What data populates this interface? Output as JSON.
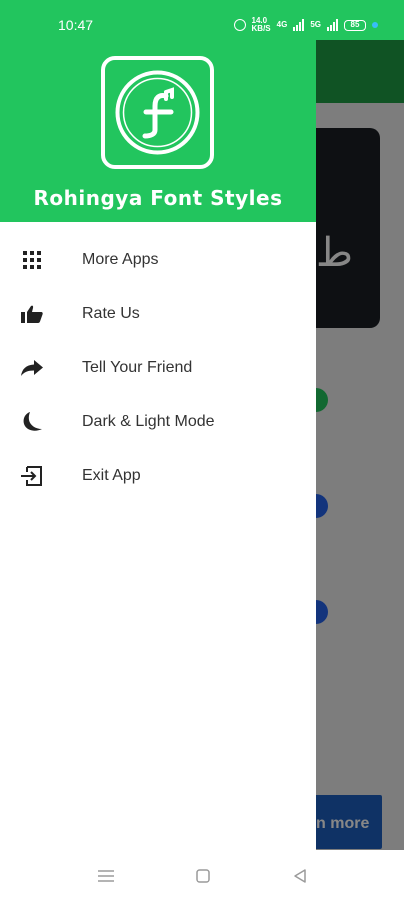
{
  "status_bar": {
    "time": "10:47",
    "net_speed_a": "14.0",
    "net_speed_a_unit": "KB/S",
    "network_type": "4G",
    "signal_label": "5G",
    "battery": "85"
  },
  "drawer": {
    "app_name": "Rohingya Font Styles",
    "logo_letter": "f",
    "menu": [
      {
        "label": "More Apps",
        "icon": "grid-icon"
      },
      {
        "label": "Rate Us",
        "icon": "thumbs-up-icon"
      },
      {
        "label": "Tell Your Friend",
        "icon": "share-arrow-icon"
      },
      {
        "label": "Dark & Light Mode",
        "icon": "moon-icon"
      },
      {
        "label": "Exit App",
        "icon": "exit-icon"
      }
    ]
  },
  "underlay": {
    "button_text": "n more",
    "card_glyph": "ط"
  },
  "colors": {
    "brand_green": "#22c55e",
    "text": "#333333",
    "underlay_button": "#1e5fbf"
  }
}
